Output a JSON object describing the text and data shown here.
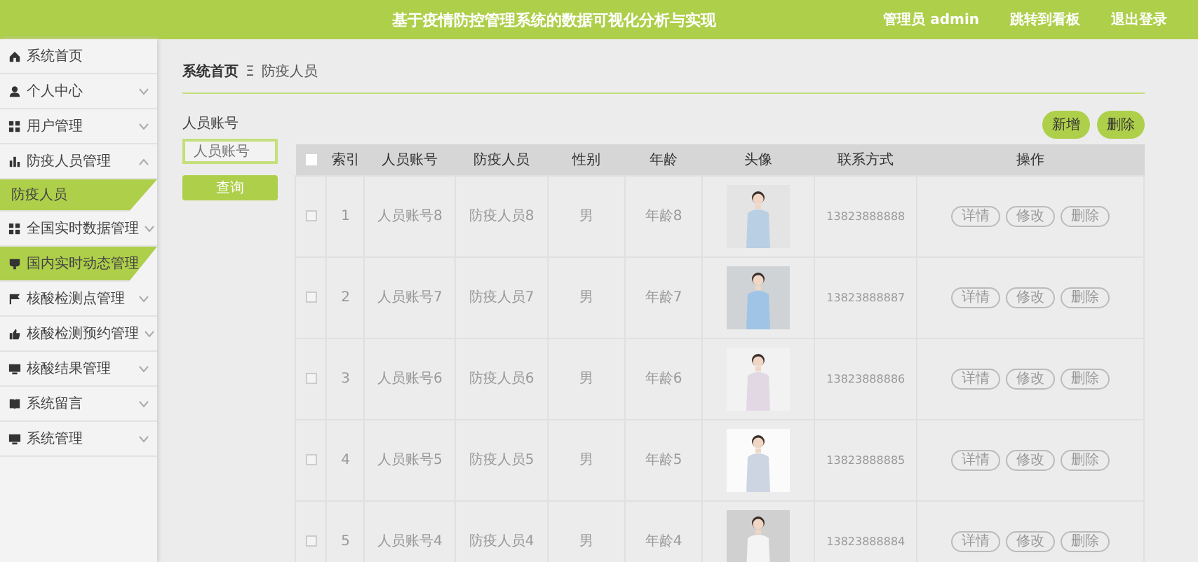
{
  "header": {
    "title": "基于疫情防控管理系统的数据可视化分析与实现",
    "links": [
      "管理员 admin",
      "跳转到看板",
      "退出登录"
    ]
  },
  "sidebar": {
    "items": [
      {
        "label": "系统首页",
        "hovered": false
      },
      {
        "label": "个人中心",
        "expanded": false,
        "hovered": false
      },
      {
        "label": "用户管理",
        "expanded": false,
        "hovered": false
      },
      {
        "label": "防疫人员管理",
        "expanded": true,
        "hovered": false,
        "children": [
          {
            "label": "防疫人员",
            "selected": true
          }
        ]
      },
      {
        "label": "全国实时数据管理",
        "expanded": false,
        "hovered": false
      },
      {
        "label": "国内实时动态管理",
        "expanded": false,
        "hovered": true
      },
      {
        "label": "核酸检测点管理",
        "expanded": false,
        "hovered": false
      },
      {
        "label": "核酸检测预约管理",
        "expanded": false,
        "hovered": false
      },
      {
        "label": "核酸结果管理",
        "expanded": false,
        "hovered": false
      },
      {
        "label": "系统留言",
        "expanded": false,
        "hovered": false
      },
      {
        "label": "系统管理",
        "expanded": false,
        "hovered": false
      }
    ]
  },
  "breadcrumb": {
    "home": "系统首页",
    "separator": "Ξ",
    "current": "防疫人员"
  },
  "search": {
    "label": "人员账号",
    "placeholder": "人员账号",
    "button": "查询"
  },
  "actions": [
    "新增",
    "删除"
  ],
  "table": {
    "header_checked": false,
    "columns": [
      "索引",
      "人员账号",
      "防疫人员",
      "性别",
      "年龄",
      "头像",
      "联系方式",
      "操作"
    ],
    "rows": [
      {
        "checked": false,
        "index": "1",
        "account": "人员账号8",
        "name": "防疫人员8",
        "gender": "男",
        "age": "年龄8",
        "phone": "13823888888",
        "buttons": [
          "详情",
          "修改",
          "删除"
        ]
      },
      {
        "checked": false,
        "index": "2",
        "account": "人员账号7",
        "name": "防疫人员7",
        "gender": "男",
        "age": "年龄7",
        "phone": "13823888887",
        "buttons": [
          "详情",
          "修改",
          "删除"
        ]
      },
      {
        "checked": false,
        "index": "3",
        "account": "人员账号6",
        "name": "防疫人员6",
        "gender": "男",
        "age": "年龄6",
        "phone": "13823888886",
        "buttons": [
          "详情",
          "修改",
          "删除"
        ]
      },
      {
        "checked": false,
        "index": "4",
        "account": "人员账号5",
        "name": "防疫人员5",
        "gender": "男",
        "age": "年龄5",
        "phone": "13823888885",
        "buttons": [
          "详情",
          "修改",
          "删除"
        ]
      },
      {
        "checked": false,
        "index": "5",
        "account": "人员账号4",
        "name": "防疫人员4",
        "gender": "男",
        "age": "年龄4",
        "phone": "13823888884",
        "buttons": [
          "详情",
          "修改",
          "删除"
        ]
      }
    ]
  }
}
